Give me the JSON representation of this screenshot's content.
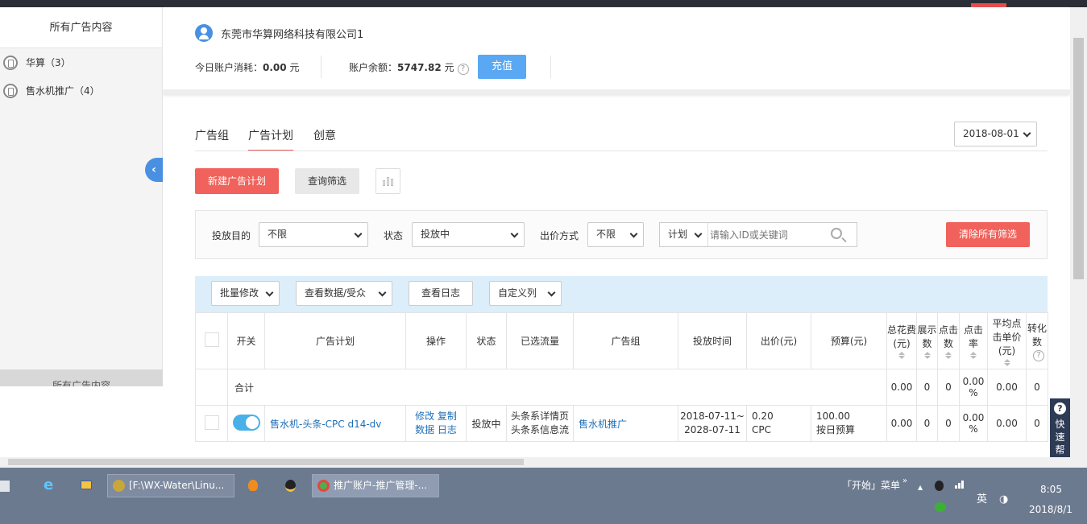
{
  "sidebar": {
    "title": "所有广告内容",
    "items": [
      {
        "label": "华算（3）"
      },
      {
        "label": "售水机推广（4）"
      }
    ],
    "footer": "所有广告内容"
  },
  "account": {
    "company": "东莞市华算网络科技有限公司1",
    "today_label": "今日账户消耗：",
    "today_value": "0.00",
    "today_unit": "元",
    "balance_label": "账户余额：",
    "balance_value": "5747.82",
    "balance_unit": "元",
    "recharge_label": "充值"
  },
  "tabs": [
    {
      "label": "广告组",
      "active": false
    },
    {
      "label": "广告计划",
      "active": true
    },
    {
      "label": "创意",
      "active": false
    }
  ],
  "date": "2018-08-01",
  "actions": {
    "new_plan": "新建广告计划",
    "query": "查询筛选"
  },
  "filters": {
    "purpose_label": "投放目的",
    "purpose_value": "不限",
    "status_label": "状态",
    "status_value": "投放中",
    "bid_label": "出价方式",
    "bid_value": "不限",
    "search_scope": "计划",
    "search_placeholder": "请输入ID或关键词",
    "clear_all": "清除所有筛选"
  },
  "table_toolbar": {
    "batch_edit": "批量修改",
    "view_data": "查看数据/受众",
    "view_log": "查看日志",
    "custom_cols": "自定义列"
  },
  "table": {
    "headers": [
      "开关",
      "广告计划",
      "操作",
      "状态",
      "已选流量",
      "广告组",
      "投放时间",
      "出价(元)",
      "预算(元)",
      "总花费(元)",
      "展示数",
      "点击数",
      "点击率",
      "平均点击单价(元)",
      "转化数"
    ],
    "summary": {
      "label": "合计",
      "total_cost": "0.00",
      "impressions": "0",
      "clicks": "0",
      "ctr": "0.00 %",
      "avg_cpc": "0.00",
      "conversions": "0"
    },
    "rows": [
      {
        "plan_name": "售水机-头条-CPC d14-dv",
        "ops": [
          "修改",
          "复制",
          "数据",
          "日志"
        ],
        "status": "投放中",
        "traffic_1": "头条系详情页",
        "traffic_2": "头条系信息流",
        "group": "售水机推广",
        "time_start": "2018-07-11~",
        "time_end": "2028-07-11",
        "bid_value": "0.20",
        "bid_type": "CPC",
        "budget_value": "100.00",
        "budget_type": "按日预算",
        "total_cost": "0.00",
        "impressions": "0",
        "clicks": "0",
        "ctr": "0.00 %",
        "avg_cpc": "0.00",
        "conversions": "0"
      }
    ]
  },
  "quick_help": "快速帮助",
  "taskbar": {
    "tasks": [
      "[F:\\WX-Water\\Linu...",
      "推广账户-推广管理-..."
    ],
    "start_menu": "「开始」菜单",
    "ime": "英",
    "time": "8:05",
    "date": "2018/8/1"
  }
}
